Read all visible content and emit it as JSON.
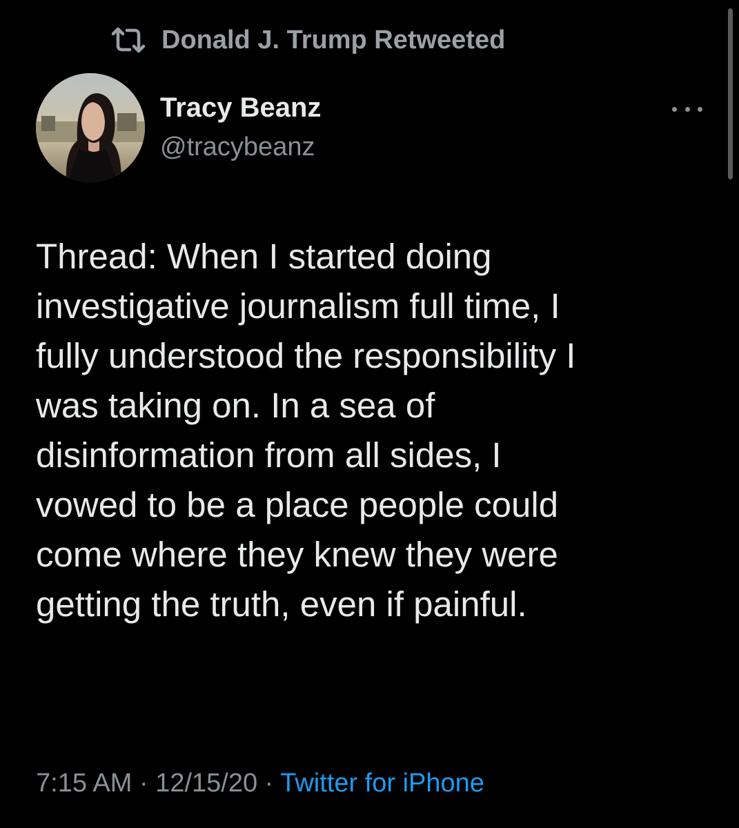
{
  "retweet": {
    "icon": "retweet-icon",
    "text": "Donald J. Trump Retweeted"
  },
  "author": {
    "name": "Tracy Beanz",
    "handle": "@tracybeanz",
    "avatar_icon": "profile-photo"
  },
  "tweet": {
    "text": "Thread: When I started doing\ninvestigative journalism full time, I\nfully understood the responsibility I\nwas taking on. In a sea of\ndisinformation from all sides, I\nvowed to be a place people could\ncome where they knew they were\ngetting the truth, even if painful."
  },
  "meta": {
    "time": "7:15 AM",
    "separator": " · ",
    "date": "12/15/20",
    "source": "Twitter for iPhone"
  },
  "colors": {
    "background": "#000000",
    "text": "#e7e9ea",
    "secondary_text": "#8b9096",
    "link": "#1d9bf0"
  }
}
